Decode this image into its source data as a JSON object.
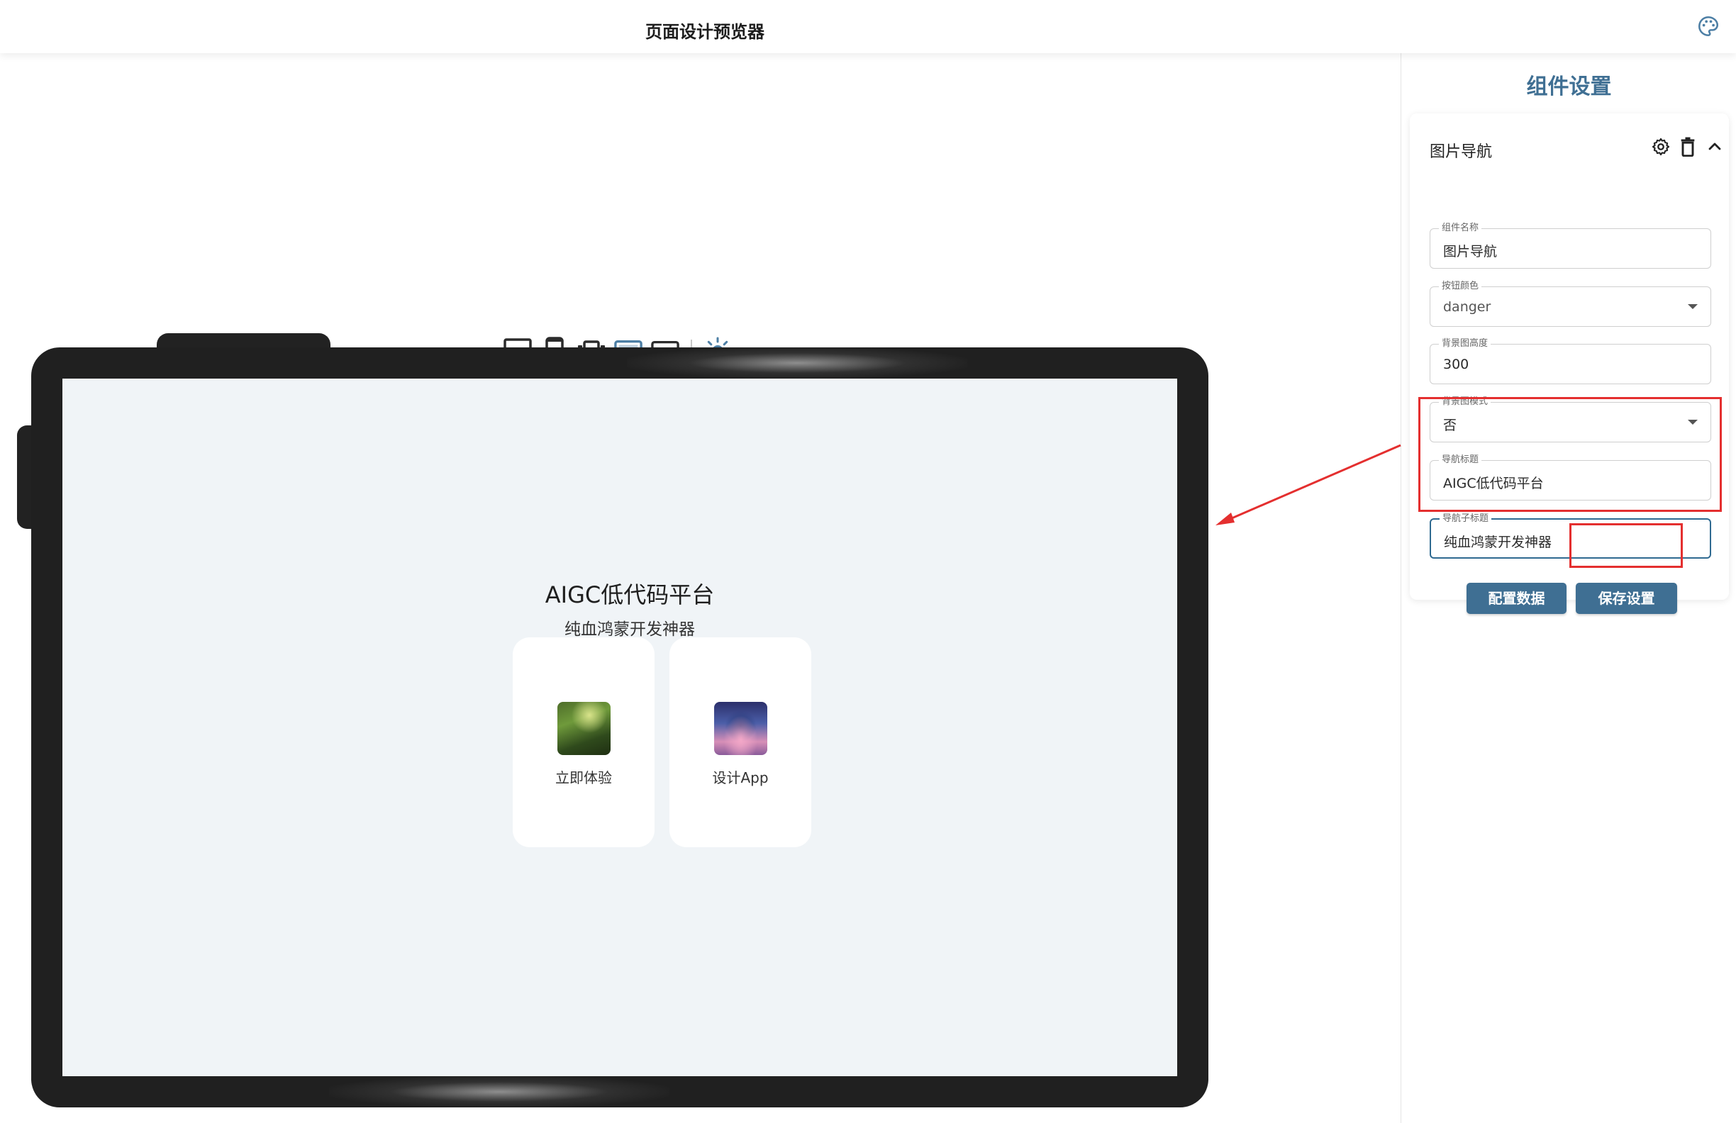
{
  "header": {
    "title": "页面设计预览器",
    "theme_icon": "palette-icon"
  },
  "preview": {
    "device_toolbar": {
      "buttons": [
        "desktop-icon",
        "phone-icon",
        "foldable-icon",
        "tablet-landscape-icon",
        "tablet-frameless-icon"
      ],
      "selected": "tablet-landscape-icon",
      "theme_toggle": "sun-icon"
    },
    "screen": {
      "nav_title": "AIGC低代码平台",
      "nav_subtitle": "纯血鸿蒙开发神器",
      "cards": [
        {
          "label": "立即体验",
          "image": "green-plant-image"
        },
        {
          "label": "设计App",
          "image": "floating-castle-image"
        }
      ]
    }
  },
  "settings": {
    "panel_title": "组件设置",
    "component_header": "图片导航",
    "header_icons": [
      "gear-icon",
      "trash-icon",
      "chevron-up-icon"
    ],
    "fields": {
      "component_name": {
        "label": "组件名称",
        "value": "图片导航"
      },
      "button_color": {
        "label": "按钮颜色",
        "value": "danger"
      },
      "bg_height": {
        "label": "背景图高度",
        "value": "300"
      },
      "bg_mode": {
        "label": "背景图模式",
        "value": "否"
      },
      "nav_title": {
        "label": "导航标题",
        "value": "AIGC低代码平台"
      },
      "nav_subtitle": {
        "label": "导航子标题",
        "value": "纯血鸿蒙开发神器"
      }
    },
    "buttons": {
      "config_data": "配置数据",
      "save_settings": "保存设置"
    }
  },
  "colors": {
    "accent": "#3f6f93",
    "annotation_red": "#e42f2f",
    "device_frame": "#202020",
    "screen_bg": "#f0f4f7"
  }
}
